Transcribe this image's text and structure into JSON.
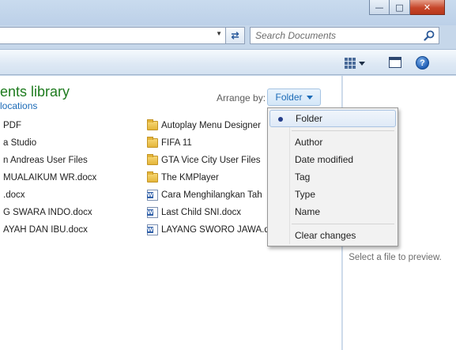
{
  "window": {
    "minimize_glyph": "—",
    "maximize_glyph": "□",
    "close_glyph": "✕"
  },
  "address": {
    "dropdown_glyph": "▼",
    "refresh_glyph": "⇄"
  },
  "search": {
    "placeholder": "Search Documents"
  },
  "toolbar": {
    "help_glyph": "?"
  },
  "library": {
    "title": "ents library",
    "subtitle": "locations",
    "arrange_label": "Arrange by:",
    "arrange_value": "Folder"
  },
  "files_left": [
    {
      "name": "PDF",
      "type": "folder"
    },
    {
      "name": "a Studio",
      "type": "folder"
    },
    {
      "name": "n Andreas User Files",
      "type": "folder"
    },
    {
      "name": "MUALAIKUM  WR.docx",
      "type": "docx"
    },
    {
      "name": ".docx",
      "type": "docx"
    },
    {
      "name": "G SWARA INDO.docx",
      "type": "docx"
    },
    {
      "name": "AYAH DAN IBU.docx",
      "type": "docx"
    }
  ],
  "files_right": [
    {
      "name": "Autoplay Menu Designer",
      "type": "folder"
    },
    {
      "name": "FIFA 11",
      "type": "folder"
    },
    {
      "name": "GTA Vice City User Files",
      "type": "folder"
    },
    {
      "name": "The KMPlayer",
      "type": "folder"
    },
    {
      "name": "Cara Menghilangkan Tah",
      "type": "docx"
    },
    {
      "name": "Last Child SNI.docx",
      "type": "docx"
    },
    {
      "name": "LAYANG SWORO JAWA.d",
      "type": "docx"
    }
  ],
  "arrange_menu": {
    "items": [
      {
        "label": "Folder",
        "selected": true
      },
      {
        "label": "Author",
        "selected": false
      },
      {
        "label": "Date modified",
        "selected": false
      },
      {
        "label": "Tag",
        "selected": false
      },
      {
        "label": "Type",
        "selected": false
      },
      {
        "label": "Name",
        "selected": false
      }
    ],
    "clear_label": "Clear changes"
  },
  "preview": {
    "message": "Select a file to preview."
  }
}
